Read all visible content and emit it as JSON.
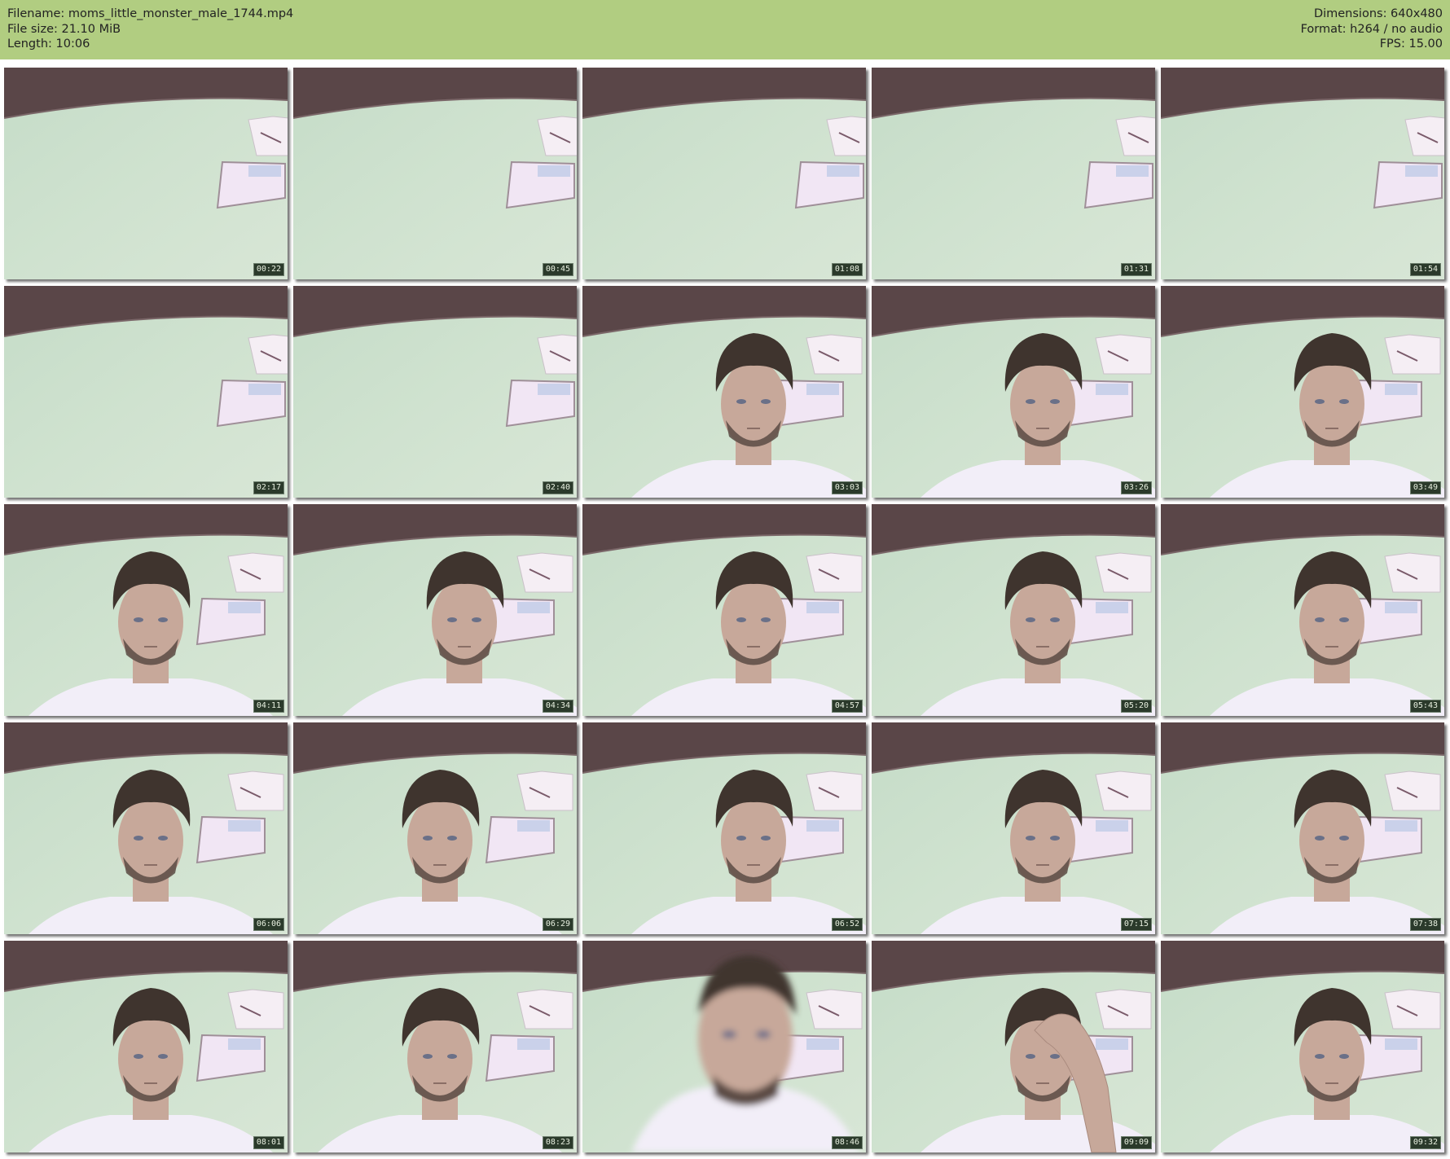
{
  "header": {
    "filename": "Filename: moms_little_monster_male_1744.mp4",
    "file_size": "File size: 21.10 MiB",
    "length": "Length: 10:06",
    "dimensions": "Dimensions: 640x480",
    "format": "Format: h264 / no audio",
    "fps": "FPS: 15.00"
  },
  "colors": {
    "header_bg": "#b1cd81",
    "wall": "#cfe2cf",
    "ceiling": "#5a4648",
    "shirt": "#f2eef8",
    "hair": "#3f342e",
    "skin": "#c7a89a"
  },
  "frames": [
    {
      "time": "00:22",
      "person": "none"
    },
    {
      "time": "00:45",
      "person": "none"
    },
    {
      "time": "01:08",
      "person": "none"
    },
    {
      "time": "01:31",
      "person": "none"
    },
    {
      "time": "01:54",
      "person": "none"
    },
    {
      "time": "02:17",
      "person": "none"
    },
    {
      "time": "02:40",
      "person": "none"
    },
    {
      "time": "03:03",
      "person": "center"
    },
    {
      "time": "03:26",
      "person": "center"
    },
    {
      "time": "03:49",
      "person": "center"
    },
    {
      "time": "04:11",
      "person": "left"
    },
    {
      "time": "04:34",
      "person": "center"
    },
    {
      "time": "04:57",
      "person": "center"
    },
    {
      "time": "05:20",
      "person": "center"
    },
    {
      "time": "05:43",
      "person": "center"
    },
    {
      "time": "06:06",
      "person": "left"
    },
    {
      "time": "06:29",
      "person": "left"
    },
    {
      "time": "06:52",
      "person": "center"
    },
    {
      "time": "07:15",
      "person": "center"
    },
    {
      "time": "07:38",
      "person": "center"
    },
    {
      "time": "08:01",
      "person": "left"
    },
    {
      "time": "08:23",
      "person": "left"
    },
    {
      "time": "08:46",
      "person": "close-blurred"
    },
    {
      "time": "09:09",
      "person": "hand-on-head"
    },
    {
      "time": "09:32",
      "person": "center"
    }
  ]
}
